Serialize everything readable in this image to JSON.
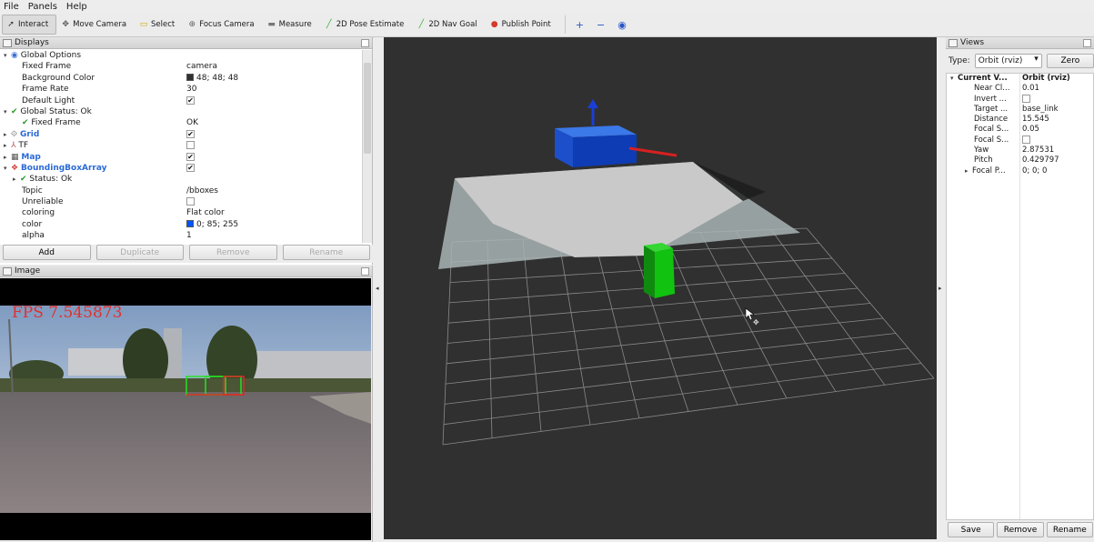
{
  "menu": [
    "File",
    "Panels",
    "Help"
  ],
  "toolbar": {
    "tools": [
      {
        "label": "Interact",
        "icon": "cursor-icon",
        "glyph": "➚",
        "color": "#333333",
        "active": true
      },
      {
        "label": "Move Camera",
        "icon": "move-camera-icon",
        "glyph": "✥",
        "color": "#555555"
      },
      {
        "label": "Select",
        "icon": "select-icon",
        "glyph": "▭",
        "color": "#c9a400"
      },
      {
        "label": "Focus Camera",
        "icon": "focus-camera-icon",
        "glyph": "⊕",
        "color": "#666666"
      },
      {
        "label": "Measure",
        "icon": "measure-icon",
        "glyph": "▬",
        "color": "#777777"
      },
      {
        "label": "2D Pose Estimate",
        "icon": "pose-estimate-icon",
        "glyph": "╱",
        "color": "#2fae2f"
      },
      {
        "label": "2D Nav Goal",
        "icon": "nav-goal-icon",
        "glyph": "╱",
        "color": "#2fae2f"
      },
      {
        "label": "Publish Point",
        "icon": "publish-point-icon",
        "glyph": "●",
        "color": "#d23b2b"
      }
    ],
    "extra": [
      "+",
      "−",
      "◉"
    ]
  },
  "displays": {
    "title": "Displays",
    "rows": [
      {
        "indent": 0,
        "arrow": "▾",
        "icon": "globe-icon",
        "glyph": "◉",
        "iconColor": "#3a6fd6",
        "name": "Global Options",
        "value": ""
      },
      {
        "indent": 2,
        "name": "Fixed Frame",
        "value": "camera"
      },
      {
        "indent": 2,
        "name": "Background Color",
        "value": "48; 48; 48",
        "swatch": "#303030"
      },
      {
        "indent": 2,
        "name": "Frame Rate",
        "value": "30"
      },
      {
        "indent": 2,
        "name": "Default Light",
        "check": true
      },
      {
        "indent": 0,
        "arrow": "▾",
        "icon": "check-icon",
        "glyph": "✔",
        "iconColor": "#2b9b2b",
        "name": "Global Status: Ok",
        "value": ""
      },
      {
        "indent": 2,
        "icon": "check-icon",
        "glyph": "✔",
        "iconColor": "#2b9b2b",
        "name": "Fixed Frame",
        "value": "OK"
      },
      {
        "indent": 0,
        "arrow": "▸",
        "icon": "grid-icon",
        "glyph": "⟐",
        "iconColor": "#555555",
        "name": "Grid",
        "blue": true,
        "check": true
      },
      {
        "indent": 0,
        "arrow": "▸",
        "icon": "tf-icon",
        "glyph": "⅄",
        "iconColor": "#aa5555",
        "name": "TF",
        "check": false
      },
      {
        "indent": 0,
        "arrow": "▸",
        "icon": "map-icon",
        "glyph": "▦",
        "iconColor": "#555555",
        "name": "Map",
        "blue": true,
        "check": true
      },
      {
        "indent": 0,
        "arrow": "▾",
        "icon": "bounding-box-icon",
        "glyph": "❖",
        "iconColor": "#d64545",
        "name": "BoundingBoxArray",
        "blue": true,
        "check": true
      },
      {
        "indent": 1,
        "arrow": "▸",
        "icon": "check-icon",
        "glyph": "✔",
        "iconColor": "#2b9b2b",
        "name": "Status: Ok",
        "value": ""
      },
      {
        "indent": 2,
        "name": "Topic",
        "value": "/bboxes"
      },
      {
        "indent": 2,
        "name": "Unreliable",
        "check": false
      },
      {
        "indent": 2,
        "name": "coloring",
        "value": "Flat color"
      },
      {
        "indent": 2,
        "name": "color",
        "value": "0; 85; 255",
        "swatch": "#0055ff"
      },
      {
        "indent": 2,
        "name": "alpha",
        "value": "1"
      }
    ],
    "buttons": [
      {
        "label": "Add",
        "name": "add-button",
        "enabled": true
      },
      {
        "label": "Duplicate",
        "name": "duplicate-button",
        "enabled": false
      },
      {
        "label": "Remove",
        "name": "remove-button",
        "enabled": false
      },
      {
        "label": "Rename",
        "name": "rename-button",
        "enabled": false
      }
    ]
  },
  "image_panel": {
    "title": "Image",
    "fps": "FPS 7.545873"
  },
  "views": {
    "title": "Views",
    "type_label": "Type:",
    "type_value": "Orbit (rviz)",
    "zero_label": "Zero",
    "rows": [
      {
        "arrow": "▾",
        "name": "Current V...",
        "value": "Orbit (rviz)",
        "bold": true
      },
      {
        "name": "Near Cl...",
        "value": "0.01"
      },
      {
        "name": "Invert ...",
        "check": true
      },
      {
        "name": "Target ...",
        "value": "base_link"
      },
      {
        "name": "Distance",
        "value": "15.545"
      },
      {
        "name": "Focal S...",
        "value": "0.05"
      },
      {
        "name": "Focal S...",
        "check": true
      },
      {
        "name": "Yaw",
        "value": "2.87531"
      },
      {
        "name": "Pitch",
        "value": "0.429797"
      },
      {
        "arrow": "▸",
        "name": "Focal P...",
        "value": "0; 0; 0"
      }
    ],
    "buttons": [
      "Save",
      "Remove",
      "Rename"
    ]
  },
  "colors": {
    "background": "#303030",
    "bbox_blue": "#0055ff",
    "bbox_green": "#00cc00"
  }
}
